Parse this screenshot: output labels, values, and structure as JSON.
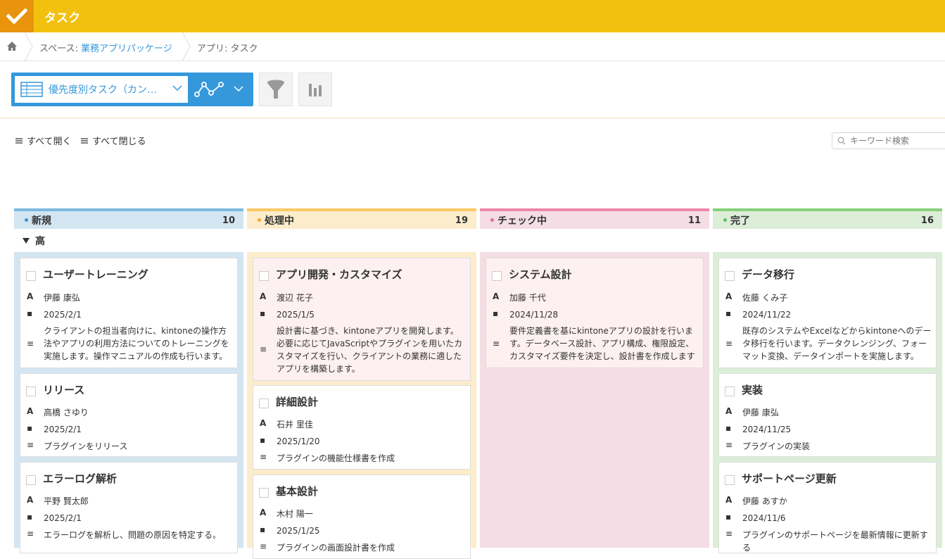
{
  "app": {
    "title": "タスク"
  },
  "breadcrumb": {
    "space_prefix": "スペース: ",
    "space_name": "業務アプリパッケージ",
    "app_crumb": "アプリ: タスク"
  },
  "toolbar": {
    "view_name": "優先度別タスク（カン…"
  },
  "controls": {
    "open_all": "すべて開く",
    "close_all": "すべて閉じる",
    "search_placeholder": "キーワード検索"
  },
  "lane": {
    "label": "高"
  },
  "colors": {
    "header": "#f2c10f",
    "accent": "#3498db"
  },
  "columns": [
    {
      "label": "新規",
      "count": "10",
      "cards": [
        {
          "title": "ユーザートレーニング",
          "assignee": "伊藤 康弘",
          "date": "2025/2/1",
          "description": "クライアントの担当者向けに、kintoneの操作方法やアプリの利用方法についてのトレーニングを実施します。操作マニュアルの作成も行います。"
        },
        {
          "title": "リリース",
          "assignee": "高橋 さゆり",
          "date": "2025/2/1",
          "description": "プラグインをリリース"
        },
        {
          "title": "エラーログ解析",
          "assignee": "平野 賢太郎",
          "date": "2025/2/1",
          "description": "エラーログを解析し、問題の原因を特定する。"
        }
      ]
    },
    {
      "label": "処理中",
      "count": "19",
      "cards": [
        {
          "title": "アプリ開発・カスタマイズ",
          "assignee": "渡辺 花子",
          "date": "2025/1/5",
          "description": "設計書に基づき、kintoneアプリを開発します。必要に応じてJavaScriptやプラグインを用いたカスタマイズを行い、クライアントの業務に適したアプリを構築します。"
        },
        {
          "title": "詳細設計",
          "assignee": "石井 里佳",
          "date": "2025/1/20",
          "description": "プラグインの機能仕様書を作成"
        },
        {
          "title": "基本設計",
          "assignee": "木村 陽一",
          "date": "2025/1/25",
          "description": "プラグインの画面設計書を作成"
        }
      ]
    },
    {
      "label": "チェック中",
      "count": "11",
      "cards": [
        {
          "title": "システム設計",
          "assignee": "加藤 千代",
          "date": "2024/11/28",
          "description": "要件定義書を基にkintoneアプリの設計を行います。データベース設計、アプリ構成、権限設定、カスタマイズ要件を決定し、設計書を作成します"
        }
      ]
    },
    {
      "label": "完了",
      "count": "16",
      "cards": [
        {
          "title": "データ移行",
          "assignee": "佐藤 くみ子",
          "date": "2024/11/22",
          "description": "既存のシステムやExcelなどからkintoneへのデータ移行を行います。データクレンジング、フォーマット変換、データインポートを実施します。"
        },
        {
          "title": "実装",
          "assignee": "伊藤 康弘",
          "date": "2024/11/25",
          "description": "プラグインの実装"
        },
        {
          "title": "サポートページ更新",
          "assignee": "伊藤 あすか",
          "date": "2024/11/6",
          "description": "プラグインのサポートページを最新情報に更新する"
        }
      ]
    }
  ]
}
